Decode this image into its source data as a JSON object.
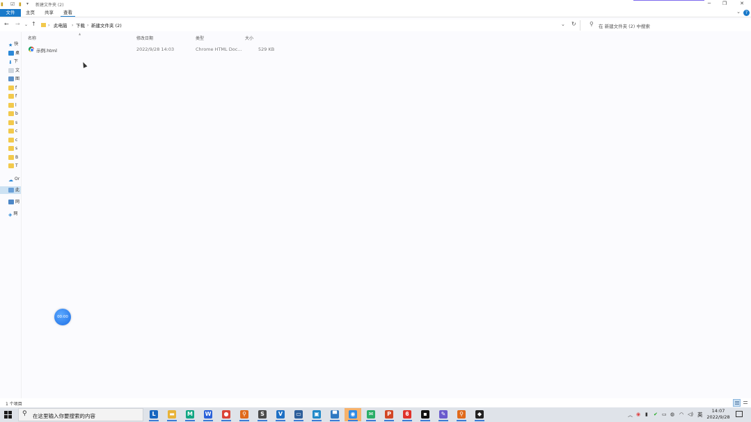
{
  "window": {
    "title": "新建文件夹 (2)",
    "accent_color": "#1979ca"
  },
  "ribbon": {
    "tabs": [
      "文件",
      "主页",
      "共享",
      "查看"
    ],
    "help_label": "?"
  },
  "address": {
    "crumbs": [
      "此电脑",
      "下载",
      "新建文件夹 (2)"
    ],
    "search_placeholder": "在 新建文件夹 (2) 中搜索"
  },
  "sidebar": {
    "items": [
      {
        "label": "快",
        "icon": "star-icon"
      },
      {
        "label": "桌",
        "icon": "desktop-icon"
      },
      {
        "label": "下",
        "icon": "download-icon"
      },
      {
        "label": "文",
        "icon": "document-icon"
      },
      {
        "label": "图",
        "icon": "picture-icon"
      },
      {
        "label": "f",
        "icon": "folder-icon"
      },
      {
        "label": "f",
        "icon": "folder-icon"
      },
      {
        "label": "l",
        "icon": "folder-icon"
      },
      {
        "label": "b",
        "icon": "folder-icon"
      },
      {
        "label": "s",
        "icon": "folder-icon"
      },
      {
        "label": "c",
        "icon": "folder-icon"
      },
      {
        "label": "c",
        "icon": "folder-icon"
      },
      {
        "label": "s",
        "icon": "folder-icon"
      },
      {
        "label": "B",
        "icon": "folder-icon"
      },
      {
        "label": "T",
        "icon": "folder-icon"
      }
    ],
    "onedrive": "Or",
    "thispc": "此",
    "network": "网",
    "homegroup": "网"
  },
  "columns": {
    "name": "名称",
    "modified": "修改日期",
    "type": "类型",
    "size": "大小"
  },
  "files": [
    {
      "name": "示例.html",
      "modified": "2022/9/28 14:03",
      "type": "Chrome HTML Doc...",
      "size": "529 KB"
    }
  ],
  "recorder": {
    "time": "00:00"
  },
  "status": {
    "count": "1 个项目"
  },
  "taskbar": {
    "search_placeholder": "在这里输入你要搜索的内容",
    "apps": [
      {
        "name": "lenovo-icon",
        "glyph": "L",
        "color": "#1565c0"
      },
      {
        "name": "file-explorer-icon",
        "glyph": "▬",
        "color": "#e8b339"
      },
      {
        "name": "mindmaster-icon",
        "glyph": "M",
        "color": "#11a683"
      },
      {
        "name": "wps-writer-icon",
        "glyph": "W",
        "color": "#2b62d9"
      },
      {
        "name": "chrome-icon",
        "glyph": "●",
        "color": "#db4437"
      },
      {
        "name": "search-tool-icon",
        "glyph": "⚲",
        "color": "#e06a1b"
      },
      {
        "name": "sublime-icon",
        "glyph": "S",
        "color": "#4a4a4a"
      },
      {
        "name": "vscode-icon",
        "glyph": "V",
        "color": "#1e70c4"
      },
      {
        "name": "terminal-icon",
        "glyph": "▭",
        "color": "#2d5e9a"
      },
      {
        "name": "remote-desktop-icon",
        "glyph": "▣",
        "color": "#1e88c8"
      },
      {
        "name": "app-window-icon",
        "glyph": "▀",
        "color": "#2f79c2"
      },
      {
        "name": "recorder-app-icon",
        "glyph": "◉",
        "color": "#2f8be6"
      },
      {
        "name": "wechat-icon",
        "glyph": "✉",
        "color": "#2aae67"
      },
      {
        "name": "powerpoint-icon",
        "glyph": "P",
        "color": "#d24625"
      },
      {
        "name": "wps-icon",
        "glyph": "ϐ",
        "color": "#e0322b"
      },
      {
        "name": "cmd-icon",
        "glyph": "▪",
        "color": "#111111"
      },
      {
        "name": "paint-icon",
        "glyph": "✎",
        "color": "#6a5acd"
      },
      {
        "name": "search-app-icon",
        "glyph": "⚲",
        "color": "#e06a1b"
      },
      {
        "name": "shield-icon",
        "glyph": "◆",
        "color": "#222222"
      }
    ],
    "ime": "英",
    "time": "14:07",
    "date": "2022/9/28"
  }
}
